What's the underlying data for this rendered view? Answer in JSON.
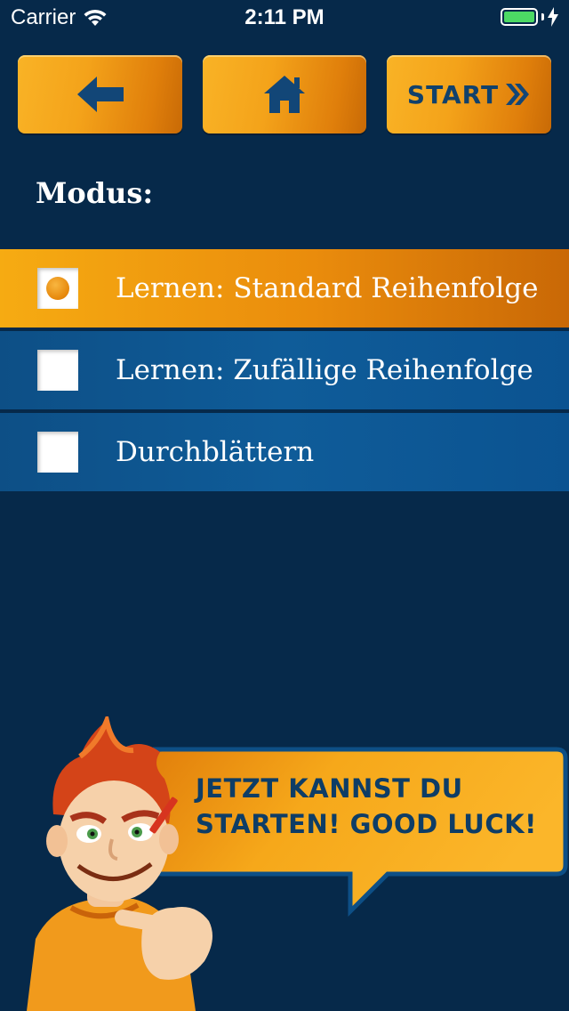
{
  "status_bar": {
    "carrier": "Carrier",
    "time": "2:11 PM"
  },
  "nav": {
    "back_icon": "arrow-left-icon",
    "home_icon": "home-icon",
    "start_label": "START",
    "start_icon": "double-chevron-right-icon"
  },
  "section_title": "Modus:",
  "options": [
    {
      "label": "Lernen: Standard Reihenfolge",
      "selected": true
    },
    {
      "label": "Lernen: Zufällige Reihenfolge",
      "selected": false
    },
    {
      "label": "Durchblättern",
      "selected": false
    }
  ],
  "speech_bubble": {
    "line1": "JETZT KANNST DU",
    "line2": "STARTEN! GOOD LUCK!"
  },
  "colors": {
    "background": "#06294a",
    "accent_orange": "#f4a31a",
    "option_blue": "#0f5c99",
    "text_dark_blue": "#0e3d66"
  }
}
